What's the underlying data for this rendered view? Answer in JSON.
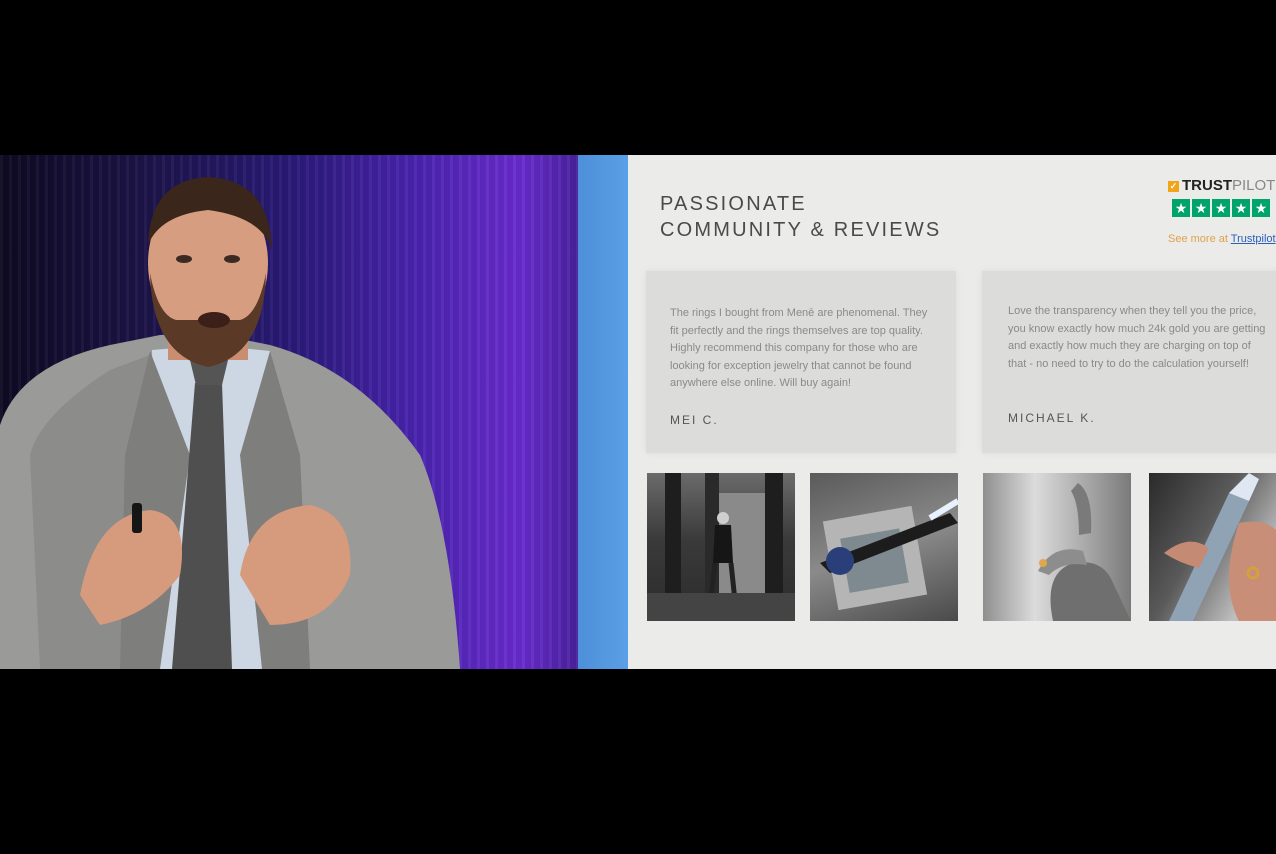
{
  "slide": {
    "title_line1": "PASSIONATE",
    "title_line2": "COMMUNITY & REVIEWS",
    "trustpilot": {
      "brand_part1": "TRUSTPILOT",
      "see_more_prefix": "See more at ",
      "see_more_link": "Trustpilot"
    },
    "reviews": [
      {
        "text": "The rings I bought from Menē are phenomenal. They fit perfectly and the rings themselves are top quality. Highly recommend this company for those who are looking for exception jewelry that cannot be found anywhere else online. Will buy again!",
        "author": "MEI C."
      },
      {
        "text": "Love the transparency when they tell you the price, you know exactly how much 24k gold you are getting and exactly how much they are charging on top of that - no need to try to do the calculation yourself!",
        "author": "MICHAEL K."
      }
    ]
  },
  "colors": {
    "trustpilot_green": "#00a36b",
    "accent_blue": "#4d8fd9"
  }
}
